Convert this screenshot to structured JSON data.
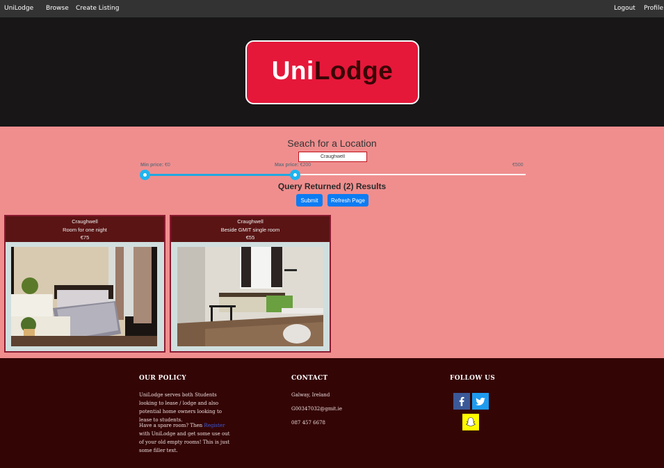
{
  "nav": {
    "brand": "UniLodge",
    "browse": "Browse",
    "create": "Create Listing",
    "logout": "Logout",
    "profile": "Profile"
  },
  "hero": {
    "logo_part1": "Uni",
    "logo_part2": "Lodge"
  },
  "search": {
    "title": "Seach for a Location",
    "input_value": "Craughwell",
    "min_label": "Min price:",
    "min_value": "€0",
    "max_label": "Max price:",
    "max_value": "€200",
    "range_max": "€500",
    "min_fraction": 0,
    "max_fraction": 0.4,
    "results": "Query Returned (2) Results",
    "submit": "Submit",
    "refresh": "Refresh Page"
  },
  "listings": [
    {
      "location": "Craughwell",
      "title": "Room for one night",
      "price": "€75"
    },
    {
      "location": "Craughwell",
      "title": "Beside GMIT single room",
      "price": "€55"
    }
  ],
  "footer": {
    "policy_title": "OUR POLICY",
    "policy_text1": "UniLodge serves both Students looking to lease / lodge and also potential home owners looking to lease to students.",
    "policy_text2a": "Have a spare room? Then",
    "policy_link": "Register",
    "policy_text2b": "with UniLodge and get some use out of your old empty rooms! This is just some filler text.",
    "contact_title": "CONTACT",
    "contact_address": "Galway, Ireland",
    "contact_email": "G00347032@gmit.ie",
    "contact_phone": "087 457 6678",
    "follow_title": "FOLLOW US",
    "icons": [
      "facebook-icon",
      "twitter-icon",
      "snapchat-icon"
    ]
  },
  "colors": {
    "navbar": "#333333",
    "hero": "#181616",
    "logo": "#e5183a",
    "page": "#f08e8e",
    "card_header": "#5a1414",
    "footer": "#340505",
    "button": "#0d7cf2",
    "slider": "#1eb4ef"
  }
}
